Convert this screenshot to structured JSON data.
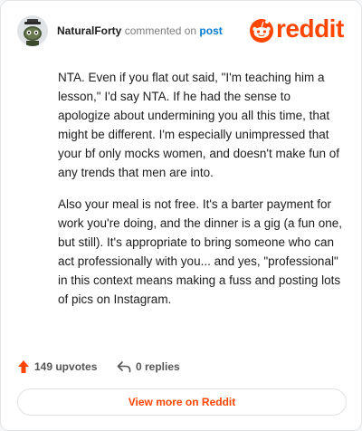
{
  "comment": {
    "author": "NaturalForty",
    "action_text": "commented on",
    "post_link": "post",
    "paragraphs": [
      "NTA. Even if you flat out said, \"I'm teaching him a lesson,\" I'd say NTA. If he had the sense to apologize about undermining you all this time, that might be different. I'm especially unimpressed that your bf only mocks women, and doesn't make fun of any trends that men are into.",
      "Also your meal is not free. It's a barter payment for work you're doing, and the dinner is a gig (a fun one, but still). It's appropriate to bring someone who can act professionally with you... and yes, \"professional\" in this context means making a fuss and posting lots of pics on Instagram."
    ],
    "upvotes": "149 upvotes",
    "replies": "0 replies"
  },
  "brand": {
    "wordmark": "reddit"
  },
  "footer": {
    "view_more": "View more on Reddit"
  },
  "colors": {
    "accent": "#ff4500",
    "link": "#0079d3"
  },
  "icons": [
    "snoo-avatar-icon",
    "reddit-snoo-logo-icon",
    "upvote-arrow-icon",
    "reply-arrow-icon"
  ]
}
